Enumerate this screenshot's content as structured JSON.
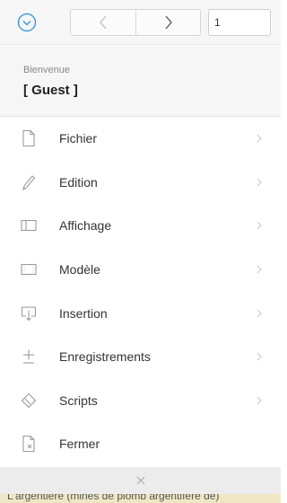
{
  "toolbar": {
    "page_number": "1"
  },
  "welcome": {
    "label": "Bienvenue",
    "user": "[ Guest ]"
  },
  "menu": {
    "items": [
      {
        "label": "Fichier",
        "icon": "file-icon"
      },
      {
        "label": "Edition",
        "icon": "pencil-icon"
      },
      {
        "label": "Affichage",
        "icon": "layout-icon"
      },
      {
        "label": "Modèle",
        "icon": "table-icon"
      },
      {
        "label": "Insertion",
        "icon": "insert-icon"
      },
      {
        "label": "Enregistrements",
        "icon": "plus-minus-icon"
      },
      {
        "label": "Scripts",
        "icon": "script-icon"
      },
      {
        "label": "Fermer",
        "icon": "close-file-icon"
      }
    ]
  },
  "background_text": "L'argentière (mines de plomb argentifère de)",
  "colors": {
    "accent": "#2f8fd8",
    "toolbar_bg": "#f6f6f6",
    "icon_gray": "#9a9a9a",
    "strip": "#efe7c4"
  }
}
